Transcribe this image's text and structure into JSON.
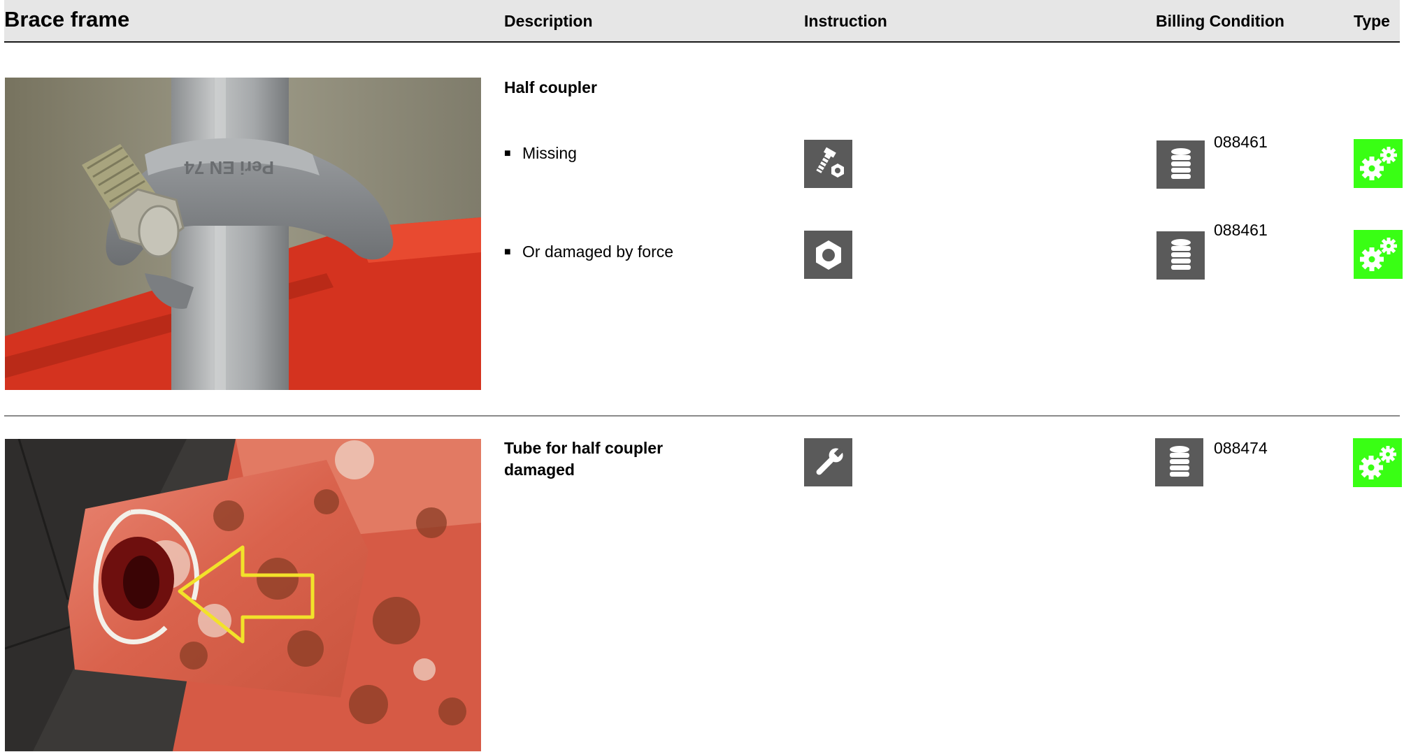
{
  "header": {
    "title": "Brace frame",
    "description": "Description",
    "instruction": "Instruction",
    "billing_condition": "Billing Condition",
    "type": "Type"
  },
  "section1": {
    "heading": "Half coupler",
    "photo_icon": "half-coupler-photo",
    "photo_stamp": "Peri EN 74",
    "rows": [
      {
        "bullet": "■",
        "text": "Missing",
        "instruction_icon": "bolt-and-nut-icon",
        "billing_icon": "coins-stack-icon",
        "billing_code": "088461",
        "type_icon": "gears-icon"
      },
      {
        "bullet": "■",
        "text": "Or damaged by force",
        "instruction_icon": "nut-icon",
        "billing_icon": "coins-stack-icon",
        "billing_code": "088461",
        "type_icon": "gears-icon"
      }
    ]
  },
  "section2": {
    "heading_line1": "Tube for half coupler",
    "heading_line2": "damaged",
    "photo_icon": "damaged-tube-photo",
    "instruction_icon": "wrench-icon",
    "billing_icon": "coins-stack-icon",
    "billing_code": "088474",
    "type_icon": "gears-icon"
  },
  "colors": {
    "header_bg": "#e6e6e6",
    "icon_bg": "#5a5a5a",
    "type_bg": "#39ff14"
  }
}
